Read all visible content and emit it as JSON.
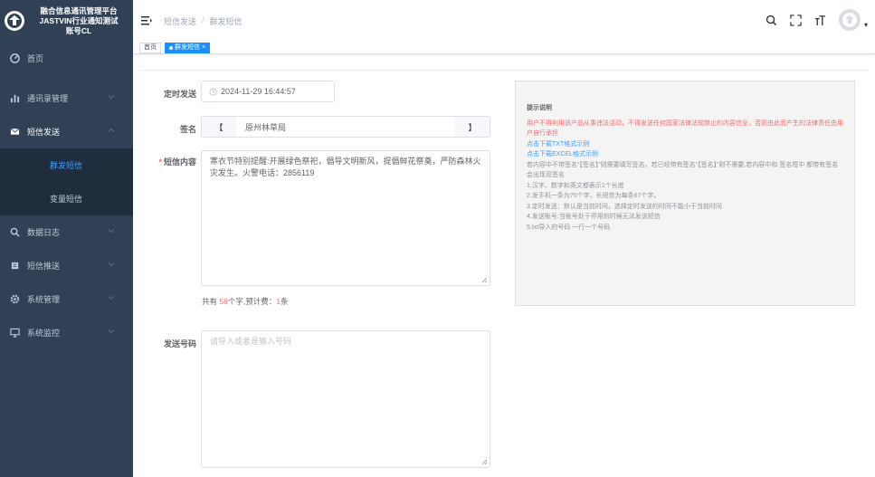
{
  "brand": {
    "title": "融合信息通讯管理平台\nJASTVIN行业通知测试\n账号CL"
  },
  "sidebar": {
    "items": [
      {
        "label": "首页",
        "icon": "dashboard-icon"
      },
      {
        "label": "通讯录管理",
        "icon": "bar-chart-icon"
      },
      {
        "label": "短信发送",
        "icon": "mail-icon"
      },
      {
        "label": "数据日志",
        "icon": "search-icon"
      },
      {
        "label": "短信推送",
        "icon": "message-icon"
      },
      {
        "label": "系统管理",
        "icon": "gear-icon"
      },
      {
        "label": "系统监控",
        "icon": "monitor-icon"
      }
    ],
    "sub_items": [
      {
        "label": "群发短信"
      },
      {
        "label": "变量短信"
      }
    ]
  },
  "breadcrumb": {
    "parent": "短信发送",
    "separator": "/",
    "current": "群发短信"
  },
  "tags": {
    "home": "首页",
    "active": "群发短信",
    "close": "×"
  },
  "form": {
    "schedule_label": "定时发送",
    "schedule_value": "2024-11-29 16:44:57",
    "sign_label": "签名",
    "sign_open": "【",
    "sign_value": "原州林草局",
    "sign_close": "】",
    "content_label": "短信内容",
    "content_value": "寒衣节特别提醒:开展绿色祭祀，倡导文明新风，提倡鲜花祭奠，严防森林火灾发生。火警电话：2856119",
    "count_prefix": "共有 ",
    "count_chars": "58",
    "count_mid": "个字,预计费：",
    "count_fee": "1",
    "count_suffix": "条",
    "phone_label": "发送号码",
    "phone_placeholder": "请导入或者是输入号码"
  },
  "tip": {
    "title": "提示说明",
    "warning": "用户不得利用该产品从事违法活动，不得发送任何国家法律法规禁止的内容信息，否则由此而产生的法律责任由用户自行承担",
    "link_txt": "点击下载TXT格式示例",
    "link_excel": "点击下载EXCEL格式示例",
    "note_sign": "若内容中不带签名“【签名】”则需要填写签名，若已经带有签名“【签名】”则不需要,若内容中和 签名框中 都带有签名会出现双签名",
    "rule1": "1.汉字、数字和英文都表示1个长度",
    "rule2": "2.发手机一条为70个字，长短信为每条67个字。",
    "rule3": "3.定时发送：默认是当前时间，选择定时发送的时间不能小于当前时间",
    "rule4": "4.发送账号:当账号处于停用的时候无法发送短信",
    "rule5": "5.txt导入的号码 一行一个号码"
  },
  "colors": {
    "sidebar_bg": "#304156",
    "submenu_bg": "#1f2d3d",
    "active": "#409eff",
    "danger": "#f56c6c"
  }
}
